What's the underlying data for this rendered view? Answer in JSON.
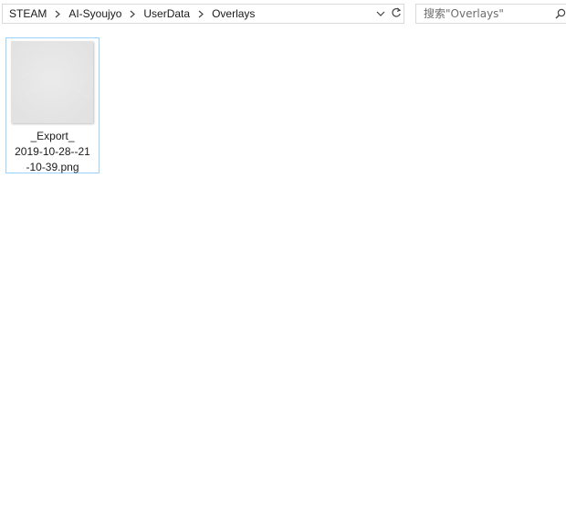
{
  "address_bar": {
    "breadcrumbs": [
      "STEAM",
      "AI-Syoujyo",
      "UserData",
      "Overlays"
    ]
  },
  "search": {
    "placeholder": "搜索\"Overlays\""
  },
  "files": [
    {
      "name_lines": [
        "_Export_",
        "2019-10-28--21",
        "-10-39.png"
      ]
    }
  ],
  "icons": {
    "breadcrumb_separator": "chevron-right-icon",
    "address_dropdown": "chevron-down-icon",
    "refresh": "refresh-icon",
    "search": "search-icon"
  },
  "colors": {
    "selection_border": "#99d1ff",
    "thumbnail_fill": "#e6e6e6",
    "border": "#d9d9d9"
  }
}
